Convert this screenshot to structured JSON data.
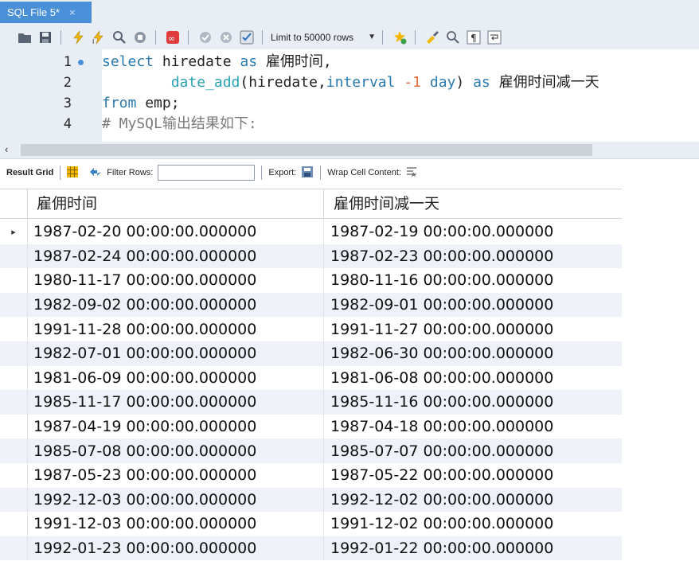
{
  "tab": {
    "title": "SQL File 5*",
    "close": "×"
  },
  "toolbar": {
    "limit_label": "Limit to 50000 rows",
    "icons": [
      "folder-open-icon",
      "save-icon",
      "execute-icon",
      "execute-selection-icon",
      "explain-icon",
      "stop-icon",
      "toggle-continue-icon",
      "commit-icon",
      "rollback-icon",
      "autocommit-icon",
      "beautify-icon",
      "find-icon",
      "invisible-chars-icon",
      "wrap-icon"
    ]
  },
  "editor": {
    "lines": [
      {
        "n": "1",
        "parts": [
          [
            "kw",
            "select"
          ],
          [
            "txt",
            " hiredate "
          ],
          [
            "kw",
            "as"
          ],
          [
            "txt",
            " 雇佣时间,"
          ]
        ]
      },
      {
        "n": "2",
        "parts": [
          [
            "txt",
            "        "
          ],
          [
            "fn",
            "date_add"
          ],
          [
            "txt",
            "(hiredate,"
          ],
          [
            "kw",
            "interval"
          ],
          [
            "txt",
            " "
          ],
          [
            "num",
            "-1"
          ],
          [
            "txt",
            " "
          ],
          [
            "kw",
            "day"
          ],
          [
            "txt",
            ") "
          ],
          [
            "kw",
            "as"
          ],
          [
            "txt",
            " 雇佣时间减一天"
          ]
        ]
      },
      {
        "n": "3",
        "parts": [
          [
            "kw",
            "from"
          ],
          [
            "txt",
            " emp;"
          ]
        ]
      },
      {
        "n": "4",
        "parts": [
          [
            "cmt",
            "# MySQL输出结果如下:"
          ]
        ]
      }
    ]
  },
  "result_toolbar": {
    "result_grid": "Result Grid",
    "filter_rows": "Filter Rows:",
    "export": "Export:",
    "wrap": "Wrap Cell Content:"
  },
  "grid": {
    "columns": [
      "雇佣时间",
      "雇佣时间减一天"
    ],
    "rows": [
      [
        "1987-02-20 00:00:00.000000",
        "1987-02-19 00:00:00.000000"
      ],
      [
        "1987-02-24 00:00:00.000000",
        "1987-02-23 00:00:00.000000"
      ],
      [
        "1980-11-17 00:00:00.000000",
        "1980-11-16 00:00:00.000000"
      ],
      [
        "1982-09-02 00:00:00.000000",
        "1982-09-01 00:00:00.000000"
      ],
      [
        "1991-11-28 00:00:00.000000",
        "1991-11-27 00:00:00.000000"
      ],
      [
        "1982-07-01 00:00:00.000000",
        "1982-06-30 00:00:00.000000"
      ],
      [
        "1981-06-09 00:00:00.000000",
        "1981-06-08 00:00:00.000000"
      ],
      [
        "1985-11-17 00:00:00.000000",
        "1985-11-16 00:00:00.000000"
      ],
      [
        "1987-04-19 00:00:00.000000",
        "1987-04-18 00:00:00.000000"
      ],
      [
        "1985-07-08 00:00:00.000000",
        "1985-07-07 00:00:00.000000"
      ],
      [
        "1987-05-23 00:00:00.000000",
        "1987-05-22 00:00:00.000000"
      ],
      [
        "1992-12-03 00:00:00.000000",
        "1992-12-02 00:00:00.000000"
      ],
      [
        "1991-12-03 00:00:00.000000",
        "1991-12-02 00:00:00.000000"
      ],
      [
        "1992-01-23 00:00:00.000000",
        "1992-01-22 00:00:00.000000"
      ]
    ],
    "current_row_marker": "▸"
  },
  "colors": {
    "accent": "#4a90d9",
    "keyword": "#2a7ab0",
    "function": "#2aa1b5",
    "number": "#e06b3a",
    "comment": "#7a7a7a",
    "alt_row": "#eef2f8"
  }
}
